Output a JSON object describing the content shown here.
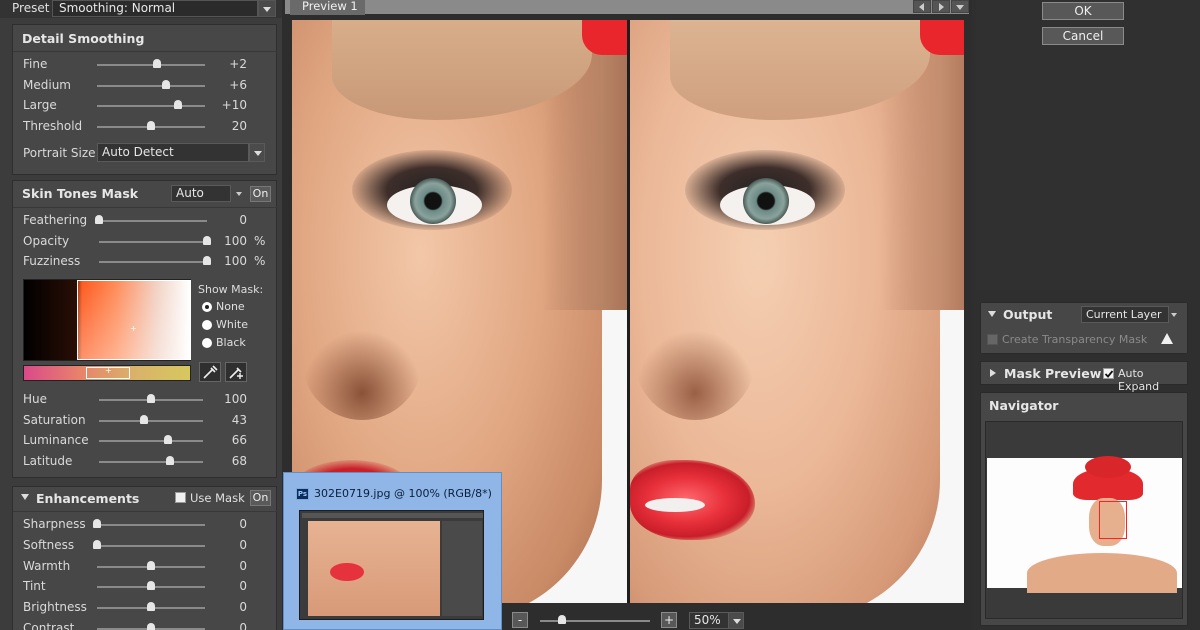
{
  "preset": {
    "label": "Preset",
    "value": "Smoothing: Normal"
  },
  "detail_smoothing": {
    "title": "Detail Smoothing",
    "sliders": [
      {
        "label": "Fine",
        "value": "+2",
        "level": 0.56
      },
      {
        "label": "Medium",
        "value": "+6",
        "level": 0.64
      },
      {
        "label": "Large",
        "value": "+10",
        "level": 0.75
      },
      {
        "label": "Threshold",
        "value": "20",
        "level": 0.5
      }
    ],
    "portrait_size": {
      "label": "Portrait Size",
      "value": "Auto Detect"
    }
  },
  "skin_tones_mask": {
    "title": "Skin Tones Mask",
    "mode": "Auto",
    "on_label": "On",
    "sliders": [
      {
        "label": "Feathering",
        "value": "0",
        "unit": "",
        "level": 0.0
      },
      {
        "label": "Opacity",
        "value": "100",
        "unit": "%",
        "level": 1.0
      },
      {
        "label": "Fuzziness",
        "value": "100",
        "unit": "%",
        "level": 1.0
      }
    ],
    "show_mask": {
      "label": "Show Mask:",
      "options": [
        "None",
        "White",
        "Black"
      ],
      "selected": "None"
    },
    "color_sliders": [
      {
        "label": "Hue",
        "value": "100",
        "level": 0.5
      },
      {
        "label": "Saturation",
        "value": "43",
        "level": 0.43
      },
      {
        "label": "Luminance",
        "value": "66",
        "level": 0.66
      },
      {
        "label": "Latitude",
        "value": "68",
        "level": 0.68
      }
    ]
  },
  "enhancements": {
    "title": "Enhancements",
    "use_mask_label": "Use Mask",
    "on_label": "On",
    "sliders": [
      {
        "label": "Sharpness",
        "value": "0",
        "level": 0.0
      },
      {
        "label": "Softness",
        "value": "0",
        "level": 0.0
      },
      {
        "label": "Warmth",
        "value": "0",
        "level": 0.5
      },
      {
        "label": "Tint",
        "value": "0",
        "level": 0.5
      },
      {
        "label": "Brightness",
        "value": "0",
        "level": 0.5
      },
      {
        "label": "Contrast",
        "value": "0",
        "level": 0.5
      }
    ]
  },
  "preview": {
    "tab_label": "Preview 1",
    "zoom_minus": "-",
    "zoom_plus": "+",
    "zoom_value": "50%",
    "zoom_level": 0.2
  },
  "ps_thumbnail": {
    "title": "302E0719.jpg @ 100% (RGB/8*)",
    "app_badge": "Ps"
  },
  "buttons": {
    "ok": "OK",
    "cancel": "Cancel"
  },
  "output": {
    "title": "Output",
    "target": "Current Layer",
    "transparency_label": "Create Transparency Mask"
  },
  "mask_preview": {
    "title": "Mask Preview",
    "auto_expand_label": "Auto Expand"
  },
  "navigator": {
    "title": "Navigator"
  },
  "colors": {
    "panel": "#474747",
    "background": "#3a3a3a",
    "lip_red": "#e8303a",
    "skin": "#e8b493",
    "thumbnail_frame": "#8fb6e6"
  }
}
